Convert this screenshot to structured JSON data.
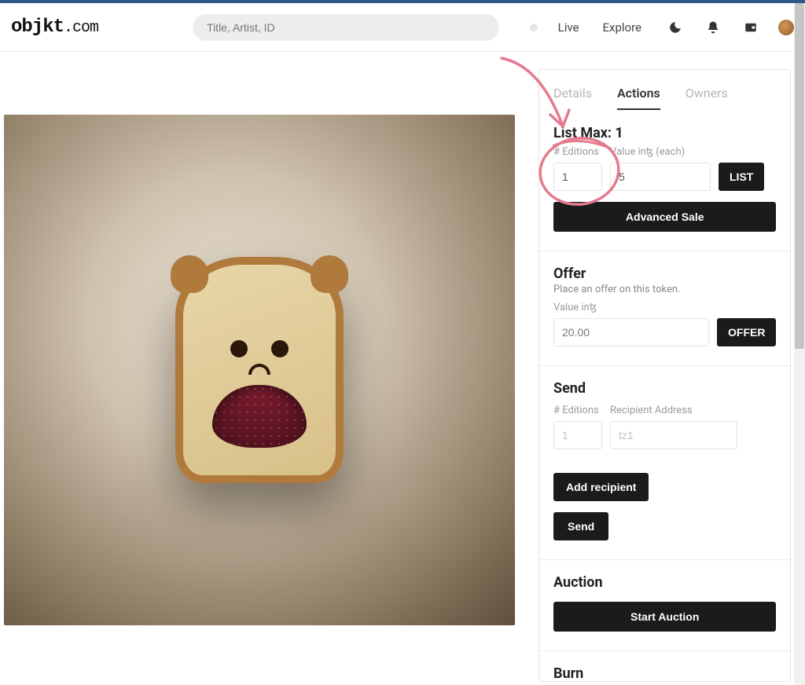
{
  "brand": {
    "name": "objkt",
    "suffix": ".com"
  },
  "header": {
    "search_placeholder": "Title, Artist, ID",
    "nav": {
      "live": "Live",
      "explore": "Explore"
    }
  },
  "tabs": {
    "details": "Details",
    "actions": "Actions",
    "owners": "Owners",
    "active": "actions"
  },
  "list": {
    "title": "List Max: 1",
    "editions_label": "# Editions",
    "editions_value": "1",
    "value_label": "Value inꜩ (each)",
    "value_value": "5",
    "list_btn": "LIST",
    "advanced_btn": "Advanced Sale"
  },
  "offer": {
    "title": "Offer",
    "subtitle": "Place an offer on this token.",
    "value_label": "Value inꜩ",
    "placeholder": "20.00",
    "btn": "OFFER"
  },
  "send": {
    "title": "Send",
    "editions_label": "# Editions",
    "editions_placeholder": "1",
    "recipient_label": "Recipient Address",
    "recipient_placeholder": "tz1",
    "add_btn": "Add recipient",
    "send_btn": "Send"
  },
  "auction": {
    "title": "Auction",
    "btn": "Start Auction"
  },
  "burn": {
    "title": "Burn"
  },
  "colors": {
    "annotation": "#e57a8e"
  }
}
